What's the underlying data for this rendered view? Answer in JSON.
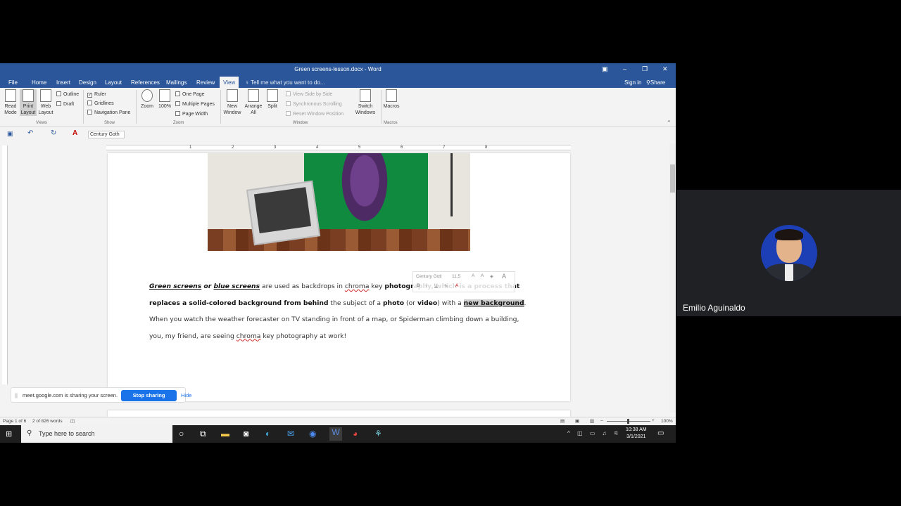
{
  "word": {
    "title": "Green screens-lesson.docx - Word",
    "window_buttons": {
      "ribbon_options": "▣",
      "minimize": "–",
      "restore": "❐",
      "close": "✕"
    },
    "menu_tabs": [
      "File",
      "Home",
      "Insert",
      "Design",
      "Layout",
      "References",
      "Mailings",
      "Review",
      "View"
    ],
    "active_tab": "View",
    "tell_me": "Tell me what you want to do...",
    "sign_in": "Sign in",
    "share": "Share",
    "ribbon": {
      "views": {
        "read_mode": "Read Mode",
        "print_layout": "Print Layout",
        "web_layout": "Web Layout",
        "outline": "Outline",
        "draft": "Draft",
        "group_label": "Views"
      },
      "show": {
        "ruler": "Ruler",
        "ruler_checked": true,
        "gridlines": "Gridlines",
        "navigation_pane": "Navigation Pane",
        "group_label": "Show"
      },
      "zoom": {
        "zoom": "Zoom",
        "hundred": "100%",
        "one_page": "One Page",
        "multiple_pages": "Multiple Pages",
        "page_width": "Page Width",
        "group_label": "Zoom"
      },
      "window": {
        "new_window": "New Window",
        "arrange_all": "Arrange All",
        "split": "Split",
        "view_side_by_side": "View Side by Side",
        "synchronous_scrolling": "Synchronous Scrolling",
        "reset_window_position": "Reset Window Position",
        "switch_windows": "Switch Windows",
        "group_label": "Window"
      },
      "macros": {
        "macros": "Macros",
        "group_label": "Macros"
      }
    },
    "qat": {
      "font": "Century Goth"
    },
    "ruler_numbers": [
      "1",
      "2",
      "3",
      "4",
      "5",
      "6",
      "7",
      "8"
    ],
    "document": {
      "p_green_screens": "Green screens",
      "p_or": " or ",
      "p_blue_screens": "blue screens",
      "p_used": " are used as backdrops in ",
      "p_chroma1": "chroma",
      "p_key": " key ",
      "p_photography": "photography",
      "p_which": ", which is a process that replaces a solid-colored background from behind",
      "p_subject": " the subject of a ",
      "p_photo": "photo",
      "p_or2": " (or ",
      "p_video": "video",
      "p_with": ") with a ",
      "p_new_bg": "new background",
      "p_rest": ". When you watch the weather forecaster on TV standing in front of a map, or Spiderman climbing down a building, you, my friend, are seeing ",
      "p_chroma2": "chroma",
      "p_end": " key photography at work!"
    },
    "mini_toolbar": {
      "font": "Century Gotl",
      "size": "11.5"
    },
    "status": {
      "page": "Page 1 of 6",
      "words": "2 of 826 words",
      "zoom": "100%"
    }
  },
  "share_banner": {
    "grip": "||",
    "message": "meet.google.com is sharing your screen.",
    "stop": "Stop sharing",
    "hide": "Hide"
  },
  "taskbar": {
    "search_placeholder": "Type here to search",
    "time": "10:38 AM",
    "date": "3/1/2021"
  },
  "meet": {
    "participant_name": "Emilio Aguinaldo"
  }
}
